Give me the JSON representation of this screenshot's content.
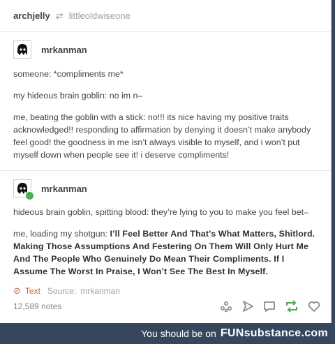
{
  "header": {
    "blog": "archjelly",
    "reblog_icon": "reblog-icon",
    "reblogged_from": "littleoldwiseone"
  },
  "posts": [
    {
      "username": "mrkanman",
      "lines": [
        "someone: *compliments me*",
        "my hideous brain goblin: no im n–",
        "me, beating the goblin with a stick: no!!! its nice having my positive traits acknowledged!! responding to affirmation by denying it doesn’t make anybody feel good! the goodness in me isn’t always visible to myself, and i won’t put myself down when people see it! i deserve compliments!"
      ]
    },
    {
      "username": "mrkanman",
      "line1": "hideous brain goblin, spitting blood: they’re lying to you to make you feel bet–",
      "line2_prefix": "me, loading my shotgun: ",
      "line2_bold": "I’ll Feel Better And That’s What Matters, Shitlord. Making Those Assumptions And Festering On Them Will Only Hurt Me And The People Who Genuinely Do Mean Their Compliments. If I Assume The Worst In Praise, I Won’t See The Best In Myself."
    }
  ],
  "source_row": {
    "type_label": "Text",
    "source_label": "Source:",
    "source_name": "mrkanman"
  },
  "footer": {
    "notes": "12,589 notes",
    "icons": [
      "share-icon",
      "send-icon",
      "reply-icon",
      "reblog-icon",
      "heart-icon"
    ]
  },
  "bottom_bar": {
    "lead": "You should be on",
    "brand": "FUNsubstance.com"
  },
  "colors": {
    "background": "#36465d",
    "text_type_accent": "#d95e40",
    "badge_green": "#4caf50"
  }
}
